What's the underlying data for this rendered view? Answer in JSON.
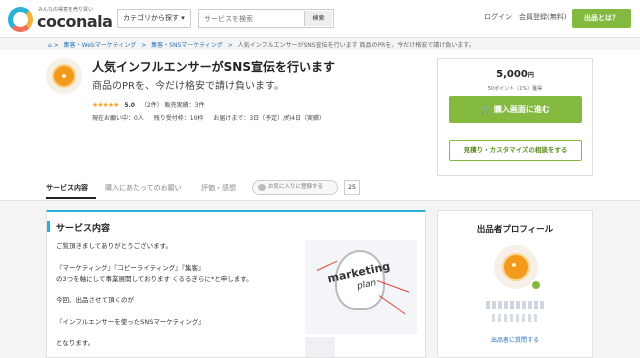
{
  "header": {
    "logo_tagline": "みんなの得意を売り買い",
    "logo_text": "coconala",
    "category_button": "カテゴリから探す ▾",
    "search_placeholder": "サービスを検索",
    "search_button": "検索",
    "login": "ログイン",
    "signup": "会員登録(無料)",
    "sell_button": "出品とは？"
  },
  "breadcrumb": {
    "items": [
      "集客・Webマーケティング",
      "集客・SNSマーケティング"
    ],
    "current": "人気インフルエンサーがSNS宣伝を行います 商品のPRを、今だけ格安で請け負います。"
  },
  "service": {
    "title": "人気インフルエンサーがSNS宣伝を行います",
    "subtitle": "商品のPRを、今だけ格安で請け負います。",
    "stars": "★★★★★",
    "score": "5.0",
    "review_count": "（2件）",
    "sales": "販売実績：3件",
    "in_progress": "現在お願い中：0人",
    "slots": "残り受付枠：10枠",
    "delivery": "お届けまで：3日（予定）/約4日（実績）"
  },
  "purchase": {
    "price": "5,000",
    "currency": "円",
    "points": "50ポイント（1%）獲得",
    "buy_button": "購入画面に進む",
    "consult_button": "見積り・カスタマイズの相談をする"
  },
  "tabs": {
    "items": [
      "サービス内容",
      "購入にあたってのお願い",
      "評価・感想"
    ],
    "favorite": "お気に入りに登録する",
    "favorite_count": "25"
  },
  "content": {
    "heading": "サービス内容",
    "lines": [
      "ご覧頂きましてありがとうございます。",
      "『マーケティング』『コピーライティング』『集客』",
      "の3つを軸にして事業展開しております くるるぎらに*と申します。",
      "今回、出品させて頂くのが",
      "『インフルエンサーを使ったSNSマーケティング』",
      "となります。"
    ],
    "image_text_1": "marketing",
    "image_text_2": "plan"
  },
  "profile": {
    "heading": "出品者プロフィール",
    "link": "出品者に質問する"
  }
}
